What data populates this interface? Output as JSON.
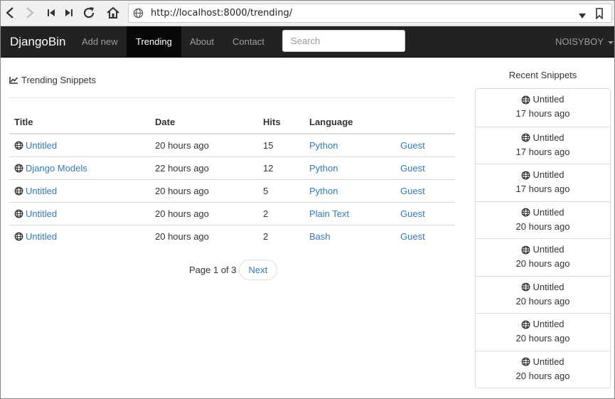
{
  "browser": {
    "url": "http://localhost:8000/trending/",
    "icons": [
      "back-icon",
      "forward-icon",
      "first-icon",
      "last-icon",
      "reload-icon",
      "home-icon",
      "globe-icon",
      "dropdown-icon",
      "bookmark-icon"
    ]
  },
  "navbar": {
    "brand": "DjangoBin",
    "items": [
      {
        "label": "Add new",
        "active": false
      },
      {
        "label": "Trending",
        "active": true
      },
      {
        "label": "About",
        "active": false
      },
      {
        "label": "Contact",
        "active": false
      }
    ],
    "search_placeholder": "Search",
    "user": "NOISYBOY"
  },
  "main": {
    "title": "Trending Snippets",
    "table": {
      "headers": [
        "Title",
        "Date",
        "Hits",
        "Language",
        ""
      ],
      "rows": [
        {
          "title": "Untitled",
          "date": "20 hours ago",
          "hits": "15",
          "language": "Python",
          "user": "Guest"
        },
        {
          "title": "Django Models",
          "date": "22 hours ago",
          "hits": "12",
          "language": "Python",
          "user": "Guest"
        },
        {
          "title": "Untitled",
          "date": "20 hours ago",
          "hits": "5",
          "language": "Python",
          "user": "Guest"
        },
        {
          "title": "Untitled",
          "date": "20 hours ago",
          "hits": "2",
          "language": "Plain Text",
          "user": "Guest"
        },
        {
          "title": "Untitled",
          "date": "20 hours ago",
          "hits": "2",
          "language": "Bash",
          "user": "Guest"
        }
      ]
    },
    "pagination": {
      "text": "Page 1 of 3",
      "next": "Next"
    }
  },
  "sidebar": {
    "title": "Recent Snippets",
    "items": [
      {
        "title": "Untitled",
        "time": "17 hours ago"
      },
      {
        "title": "Untitled",
        "time": "17 hours ago"
      },
      {
        "title": "Untitled",
        "time": "17 hours ago"
      },
      {
        "title": "Untitled",
        "time": "20 hours ago"
      },
      {
        "title": "Untitled",
        "time": "20 hours ago"
      },
      {
        "title": "Untitled",
        "time": "20 hours ago"
      },
      {
        "title": "Untitled",
        "time": "20 hours ago"
      },
      {
        "title": "Untitled",
        "time": "20 hours ago"
      }
    ]
  },
  "colors": {
    "navbar_bg": "#222222",
    "navbar_active": "#080808",
    "link": "#337ab7"
  }
}
